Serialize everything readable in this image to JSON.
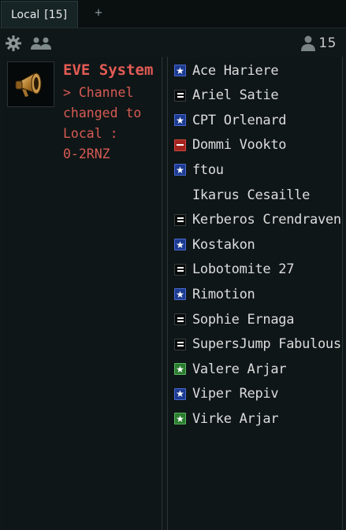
{
  "tab": {
    "name": "Local",
    "count": "[15]",
    "add_label": "+"
  },
  "toolbar": {
    "pilot_count": "15"
  },
  "message": {
    "sender": "EVE System",
    "text": "> Channel\nchanged to\nLocal :\n0-2RNZ"
  },
  "members": [
    {
      "name": "Ace Hariere",
      "standing": "blue"
    },
    {
      "name": "Ariel Satie",
      "standing": "neutral"
    },
    {
      "name": "CPT Orlenard",
      "standing": "blue"
    },
    {
      "name": "Dommi Vookto",
      "standing": "red"
    },
    {
      "name": "ftou",
      "standing": "blue"
    },
    {
      "name": "Ikarus Cesaille",
      "standing": "none"
    },
    {
      "name": "Kerberos Crendraven",
      "standing": "neutral"
    },
    {
      "name": "Kostakon",
      "standing": "blue"
    },
    {
      "name": "Lobotomite 27",
      "standing": "neutral"
    },
    {
      "name": "Rimotion",
      "standing": "blue"
    },
    {
      "name": "Sophie Ernaga",
      "standing": "neutral"
    },
    {
      "name": "SupersJump Fabulous",
      "standing": "neutral"
    },
    {
      "name": "Valere Arjar",
      "standing": "green"
    },
    {
      "name": "Viper Repiv",
      "standing": "blue"
    },
    {
      "name": "Virke Arjar",
      "standing": "green"
    }
  ],
  "colors": {
    "blue_standing": "#1c3a92",
    "green_standing": "#2a7c2e",
    "red_standing": "#a3221e",
    "system_message": "#e35b55"
  }
}
